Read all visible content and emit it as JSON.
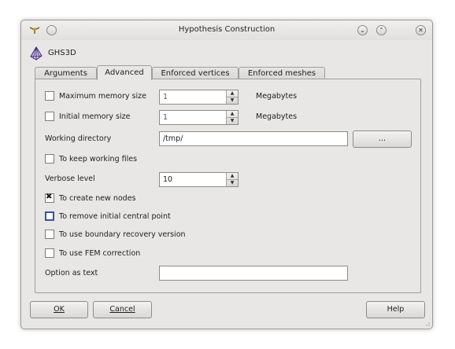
{
  "window": {
    "title": "Hypothesis Construction"
  },
  "header": {
    "algorithm": "GHS3D"
  },
  "tabs": [
    {
      "label": "Arguments"
    },
    {
      "label": "Advanced"
    },
    {
      "label": "Enforced vertices"
    },
    {
      "label": "Enforced meshes"
    }
  ],
  "advanced": {
    "max_memory": {
      "label": "Maximum memory size",
      "value": "1",
      "unit": "Megabytes",
      "checked": false
    },
    "init_memory": {
      "label": "Initial memory size",
      "value": "1",
      "unit": "Megabytes",
      "checked": false
    },
    "working_dir": {
      "label": "Working directory",
      "value": "/tmp/",
      "browse_label": "..."
    },
    "keep_files": {
      "label": "To keep working files",
      "checked": false
    },
    "verbose": {
      "label": "Verbose level",
      "value": "10"
    },
    "create_nodes": {
      "label": "To create new nodes",
      "checked": true
    },
    "remove_central": {
      "label": "To remove initial central point",
      "checked": false
    },
    "boundary_recovery": {
      "label": "To use boundary recovery version",
      "checked": false
    },
    "fem_correction": {
      "label": "To use FEM correction",
      "checked": false
    },
    "option_text": {
      "label": "Option as text",
      "value": ""
    }
  },
  "buttons": {
    "ok": "OK",
    "cancel": "Cancel",
    "help": "Help"
  }
}
